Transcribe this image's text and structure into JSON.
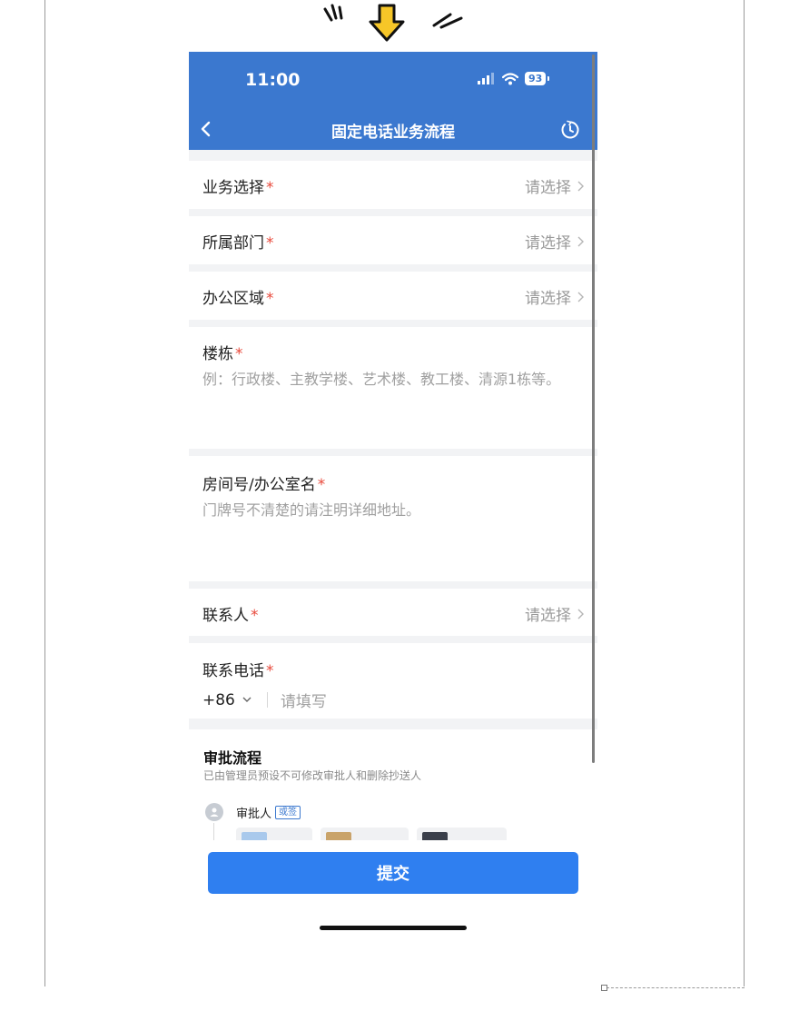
{
  "status_bar": {
    "time": "11:00",
    "battery": "93"
  },
  "nav": {
    "title": "固定电话业务流程"
  },
  "required_mark": "*",
  "fields": {
    "business": {
      "label": "业务选择",
      "value": "请选择"
    },
    "department": {
      "label": "所属部门",
      "value": "请选择"
    },
    "office_area": {
      "label": "办公区域",
      "value": "请选择"
    },
    "building": {
      "label": "楼栋",
      "placeholder": "例：行政楼、主教学楼、艺术楼、教工楼、清源1栋等。"
    },
    "room": {
      "label": "房间号/办公室名",
      "placeholder": "门牌号不清楚的请注明详细地址。"
    },
    "contact": {
      "label": "联系人",
      "value": "请选择"
    },
    "phone": {
      "label": "联系电话",
      "country_code": "+86",
      "placeholder": "请填写"
    }
  },
  "approval": {
    "title": "审批流程",
    "subtitle": "已由管理员预设不可修改审批人和删除抄送人",
    "approver_label": "审批人",
    "badge": "或签"
  },
  "footer": {
    "submit_label": "提交"
  },
  "colors": {
    "header_bg": "#3b78cf",
    "submit_bg": "#2f7ff0",
    "required": "#e8483a",
    "arrow_sticker": "#f6c628"
  }
}
